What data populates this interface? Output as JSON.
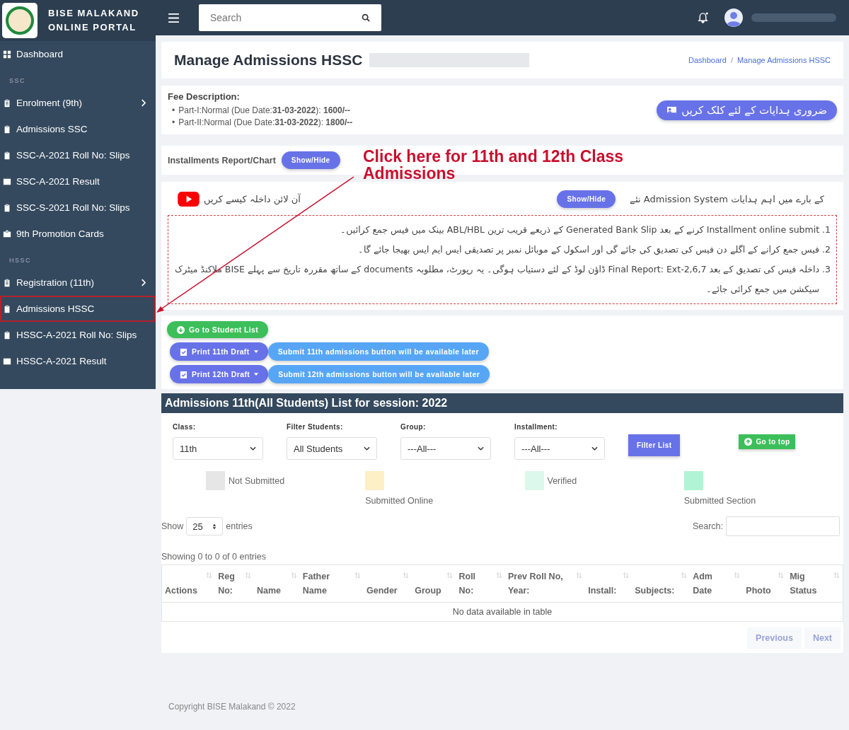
{
  "brand": {
    "title_line_1": "BISE MALAKAND",
    "title_line_2": "ONLINE PORTAL"
  },
  "sidebar": {
    "items": [
      {
        "kind": "link",
        "label": "Dashboard",
        "expandable": false,
        "highlighted": false
      },
      {
        "kind": "header",
        "label": "SSC"
      },
      {
        "kind": "link",
        "label": "Enrolment (9th)",
        "expandable": true,
        "highlighted": false
      },
      {
        "kind": "link",
        "label": "Admissions SSC",
        "expandable": false,
        "highlighted": false
      },
      {
        "kind": "link",
        "label": "SSC-A-2021 Roll No: Slips",
        "expandable": false,
        "highlighted": false
      },
      {
        "kind": "link",
        "label": "SSC-A-2021 Result",
        "expandable": false,
        "highlighted": false
      },
      {
        "kind": "link",
        "label": "SSC-S-2021 Roll No: Slips",
        "expandable": false,
        "highlighted": false
      },
      {
        "kind": "link",
        "label": "9th Promotion Cards",
        "expandable": false,
        "highlighted": false
      },
      {
        "kind": "header",
        "label": "HSSC"
      },
      {
        "kind": "link",
        "label": "Registration (11th)",
        "expandable": true,
        "highlighted": false
      },
      {
        "kind": "link",
        "label": "Admissions HSSC",
        "expandable": false,
        "highlighted": true
      },
      {
        "kind": "link",
        "label": "HSSC-A-2021 Roll No: Slips",
        "expandable": false,
        "highlighted": false
      },
      {
        "kind": "link",
        "label": "HSSC-A-2021 Result",
        "expandable": false,
        "highlighted": false
      }
    ]
  },
  "topbar": {
    "search": {
      "placeholder": "Search"
    },
    "notifications_unread": true
  },
  "page": {
    "title": "Manage Admissions HSSC",
    "breadcrumbs": [
      "Dashboard",
      "Manage Admissions HSSC"
    ],
    "breadcrumb_separator": "/"
  },
  "fee": {
    "heading": "Fee Description:",
    "items": [
      {
        "bullet": "•",
        "text": "Part-I:Normal (Due Date:**31-03-2022**): **1600/--**"
      },
      {
        "bullet": "•",
        "text": "Part-II:Normal (Due Date:**31-03-2022**): **1800/--**"
      }
    ],
    "instructions_button": "ضروری ہدایات کے لئے کلک کریں"
  },
  "installments": {
    "label": "Installments Report/Chart",
    "button": "Show/Hide"
  },
  "annotation": {
    "text": "Click here for 11th and 12th Class Admissions"
  },
  "guide": {
    "video_label": "آن لائن داخلہ کیسے کریں",
    "button": "Show/Hide",
    "heading": "نئے Admission System کے بارے میں اہم ہدایات",
    "items": [
      {
        "number": ".1",
        "text": "Installment online submit کرنے کے بعد Generated Bank Slip کے ذریعے قریب ترین ABL/HBL بینک میں فیس جمع کرائیں۔"
      },
      {
        "number": ".2",
        "text": "فیس جمع کرانے کے اگلے دن فیس کی تصدیق کی جائے گی اور اسکول کے موبائل نمبر پر تصدیقی ایس ایم ایس بھیجا جائے گا۔"
      },
      {
        "number": ".3",
        "text": "داخلہ فیس کی تصدیق کے بعد Final Report: Ext-2,6,7 ڈاؤن لوڈ کے لئے دستیاب ہوگی۔ یہ رپورٹ، مطلوبہ documents کے ساتھ مقررہ تاریخ سے پہلے BISE ملاکنڈ میٹرک سیکشن میں جمع کرائی جائے۔"
      }
    ]
  },
  "actions": {
    "student_list_button": "Go to Student List",
    "rows": [
      {
        "print": "Print 11th Draft",
        "submit": "Submit 11th admissions button will be available later"
      },
      {
        "print": "Print 12th Draft",
        "submit": "Submit 12th admissions button will be available later"
      }
    ]
  },
  "list": {
    "title": "Admissions 11th(All Students) List for session: 2022",
    "filters": [
      {
        "label": "Class:",
        "value": "11th"
      },
      {
        "label": "Filter Students:",
        "value": "All Students"
      },
      {
        "label": "Group:",
        "value": "---All---"
      },
      {
        "label": "Installment:",
        "value": "---All---"
      }
    ],
    "filter_button": "Filter List",
    "top_button": "Go to top",
    "legend": [
      {
        "label": "Not Submitted",
        "color": "#e6e6e6"
      },
      {
        "label": "Submitted Online",
        "color": "#fdefc6"
      },
      {
        "label": "Verified",
        "color": "#dcf8ec"
      },
      {
        "label": "Submitted Section",
        "color": "#b0f4d4"
      }
    ],
    "show_label": "Show",
    "page_size": "25",
    "entries_label": "entries",
    "search_label": "Search:",
    "info": "Showing 0 to 0 of 0 entries",
    "columns": [
      [
        "Actions"
      ],
      [
        "Reg",
        "No:"
      ],
      [
        "Name"
      ],
      [
        "Father",
        "Name"
      ],
      [
        "Gender"
      ],
      [
        "Group"
      ],
      [
        "Roll",
        "No:"
      ],
      [
        "Prev Roll No,",
        "Year:"
      ],
      [
        "Install:"
      ],
      [
        "Subjects:"
      ],
      [
        "Adm",
        "Date"
      ],
      [
        "Photo"
      ],
      [
        "Mig",
        "Status"
      ]
    ],
    "empty": "No data available in table",
    "previous": "Previous",
    "next": "Next"
  },
  "footer": "Copyright BISE Malakand © 2022"
}
